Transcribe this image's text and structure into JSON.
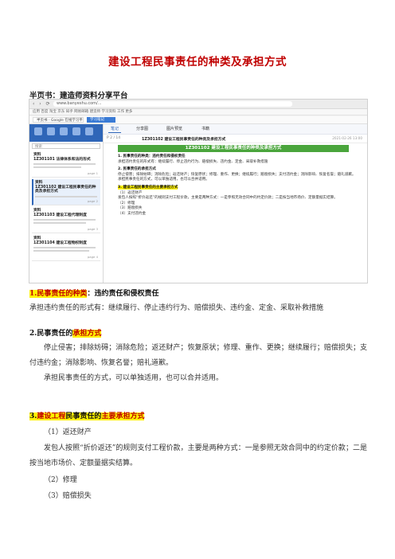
{
  "doc": {
    "title": "建设工程民事责任的种类及承担方式",
    "subtitle": "半页书：建造师资料分享平台"
  },
  "screenshot": {
    "browser": {
      "nav": "‹ › ⟳",
      "url": "www.banyeshu.com/...",
      "bookmarks": "应用   百度   淘宝   京东   知乎   网易邮箱   建造师   学习资料   工作   更多",
      "tab1": "半页书 - Google 在线学习平台",
      "tab2": "学习笔记"
    },
    "sidebar": {
      "search_placeholder": "搜索",
      "items": [
        {
          "label": "资料",
          "name": "1Z301101 法律体系和法的形式",
          "meta": "page 1"
        },
        {
          "label": "资料",
          "name": "1Z301102 建设工程民事责任的种类及承担方式",
          "meta": "page 2"
        },
        {
          "label": "资料",
          "name": "1Z301103 建设工程代理制度",
          "meta": "page 3"
        },
        {
          "label": "资料",
          "name": "1Z301104 建设工程物权制度",
          "meta": "page 4"
        }
      ]
    },
    "toolbar": {
      "btn1": "笔记",
      "btn2": "分享图",
      "btn3": "图片预览",
      "btn4": "书籍"
    },
    "crumb": {
      "page": "P 2 / 14",
      "text": "1Z301102 建设工程民事责任的种类及承担方式",
      "date": "2021-02-26 13:00"
    },
    "banner": "1Z301102  建设工程民事责任的种类及承担方式",
    "content": {
      "s1_head": "1. 民事责任的种类：违约责任和侵权责任",
      "s1_body": "承担违约责任的形式有：继续履行、停止违约行为、赔偿损失、违约金、定金、采取补救措施",
      "s2_head": "2. 民事责任的承担方式",
      "s2_body1": "停止侵害；排除妨碍；消除危险；返还财产；恢复原状；修理、重作、更换；继续履行；赔偿损失；支付违约金；消除影响、恢复名誉；赔礼道歉。",
      "s2_body2": "承担民事责任的方式，可以单独适用，也可以合并适用。",
      "s3_head": "3. 建设工程民事责任的主要承担方式",
      "s3_l1": "（1）返还财产",
      "s3_l2": "发包人按照“折价返还”的规则支付工程价款，主要是两种方式：一是参照无效合同中的约定价款；二是按当地市场价、定额量据实结算。",
      "s3_l3": "（2）修理",
      "s3_l4": "（3）赔偿损失",
      "s3_l5": "（4）支付违约金"
    }
  },
  "body": {
    "s1": {
      "num": "1.",
      "key": "民事责任的种类",
      "colon": "：",
      "rest": "违约责任和侵权责任"
    },
    "s1_text": "承担违约责任的形式有：继续履行、停止违约行为、赔偿损失、违约金、定金、采取补救措施",
    "s2": {
      "pre": "2.民事责任的",
      "key": "承担方式"
    },
    "s2_text1": "停止侵害；排除妨碍；消除危险；返还财产；恢复原状；修理、重作、更换；继续履行；赔偿损失；支付违约金；消除影响、恢复名誉；赔礼道歉。",
    "s2_text2": "承担民事责任的方式，可以单独适用，也可以合并适用。",
    "s3": {
      "num": "3.",
      "key1": "建设工程",
      "mid": "民事责任的",
      "key2": "主要承担方式"
    },
    "s3_l1": "（1）返还财产",
    "s3_l2": "发包人按照“折价返还”的规则支付工程价款，主要是两种方式：一是参照无效合同中的约定价款；二是按当地市场价、定额量据实结算。",
    "s3_l3": "（2）修理",
    "s3_l4": "（3）赔偿损失"
  }
}
